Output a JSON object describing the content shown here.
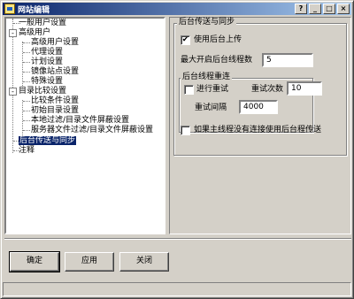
{
  "window": {
    "title": "网站编辑",
    "controls": [
      "?",
      "_",
      "□",
      "×"
    ]
  },
  "tree": {
    "items": [
      {
        "label": "一般用户设置",
        "level": 0
      },
      {
        "label": "高级用户",
        "level": 0,
        "expander": "-"
      },
      {
        "label": "高级用户设置",
        "level": 1
      },
      {
        "label": "代理设置",
        "level": 1
      },
      {
        "label": "计划设置",
        "level": 1
      },
      {
        "label": "镜像站点设置",
        "level": 1
      },
      {
        "label": "特殊设置",
        "level": 1
      },
      {
        "label": "目录比较设置",
        "level": 0,
        "expander": "-"
      },
      {
        "label": "比较条件设置",
        "level": 1
      },
      {
        "label": "初始目录设置",
        "level": 1
      },
      {
        "label": "本地过滤/目录文件屏蔽设置",
        "level": 1
      },
      {
        "label": "服务器文件过滤/目录文件屏蔽设置",
        "level": 1
      },
      {
        "label": "后台传送与同步",
        "level": 0,
        "selected": true
      },
      {
        "label": "注释",
        "level": 0
      }
    ]
  },
  "panel": {
    "group_title": "后台传送与同步",
    "use_background_upload": {
      "label": "使用后台上传",
      "checked": true
    },
    "max_threads": {
      "label": "最大开启后台线程数",
      "value": "5"
    },
    "retry_group": {
      "title": "后台线程重连",
      "retry": {
        "label": "进行重试",
        "checked": false
      },
      "retry_count": {
        "label": "重试次数",
        "value": "10"
      },
      "retry_interval": {
        "label": "重试间隔",
        "value": "4000"
      }
    },
    "fallback": {
      "label": "如果主线程没有连接使用后台程传送",
      "checked": false
    }
  },
  "buttons": {
    "ok": "确定",
    "apply": "应用",
    "close": "关闭"
  }
}
